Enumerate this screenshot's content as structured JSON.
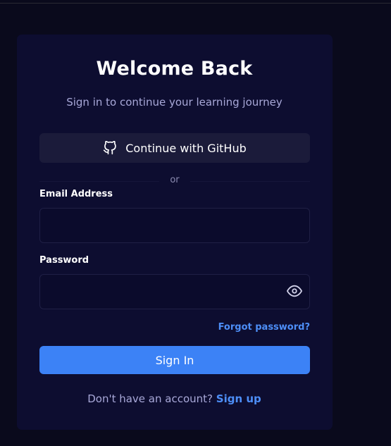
{
  "header": {
    "title": "Welcome Back",
    "subtitle": "Sign in to continue your learning journey"
  },
  "github": {
    "label": "Continue with GitHub",
    "icon": "github-icon"
  },
  "divider": {
    "text": "or"
  },
  "email": {
    "label": "Email Address",
    "value": "",
    "placeholder": ""
  },
  "password": {
    "label": "Password",
    "value": "",
    "placeholder": "",
    "toggle_icon": "eye-icon"
  },
  "forgot": {
    "label": "Forgot password?"
  },
  "submit": {
    "label": "Sign In"
  },
  "footer": {
    "prompt": "Don't have an account?",
    "link": "Sign up"
  },
  "colors": {
    "background": "#0a0a1c",
    "card": "#0d0d30",
    "accent": "#3c82f6",
    "link": "#4d8ef7"
  }
}
